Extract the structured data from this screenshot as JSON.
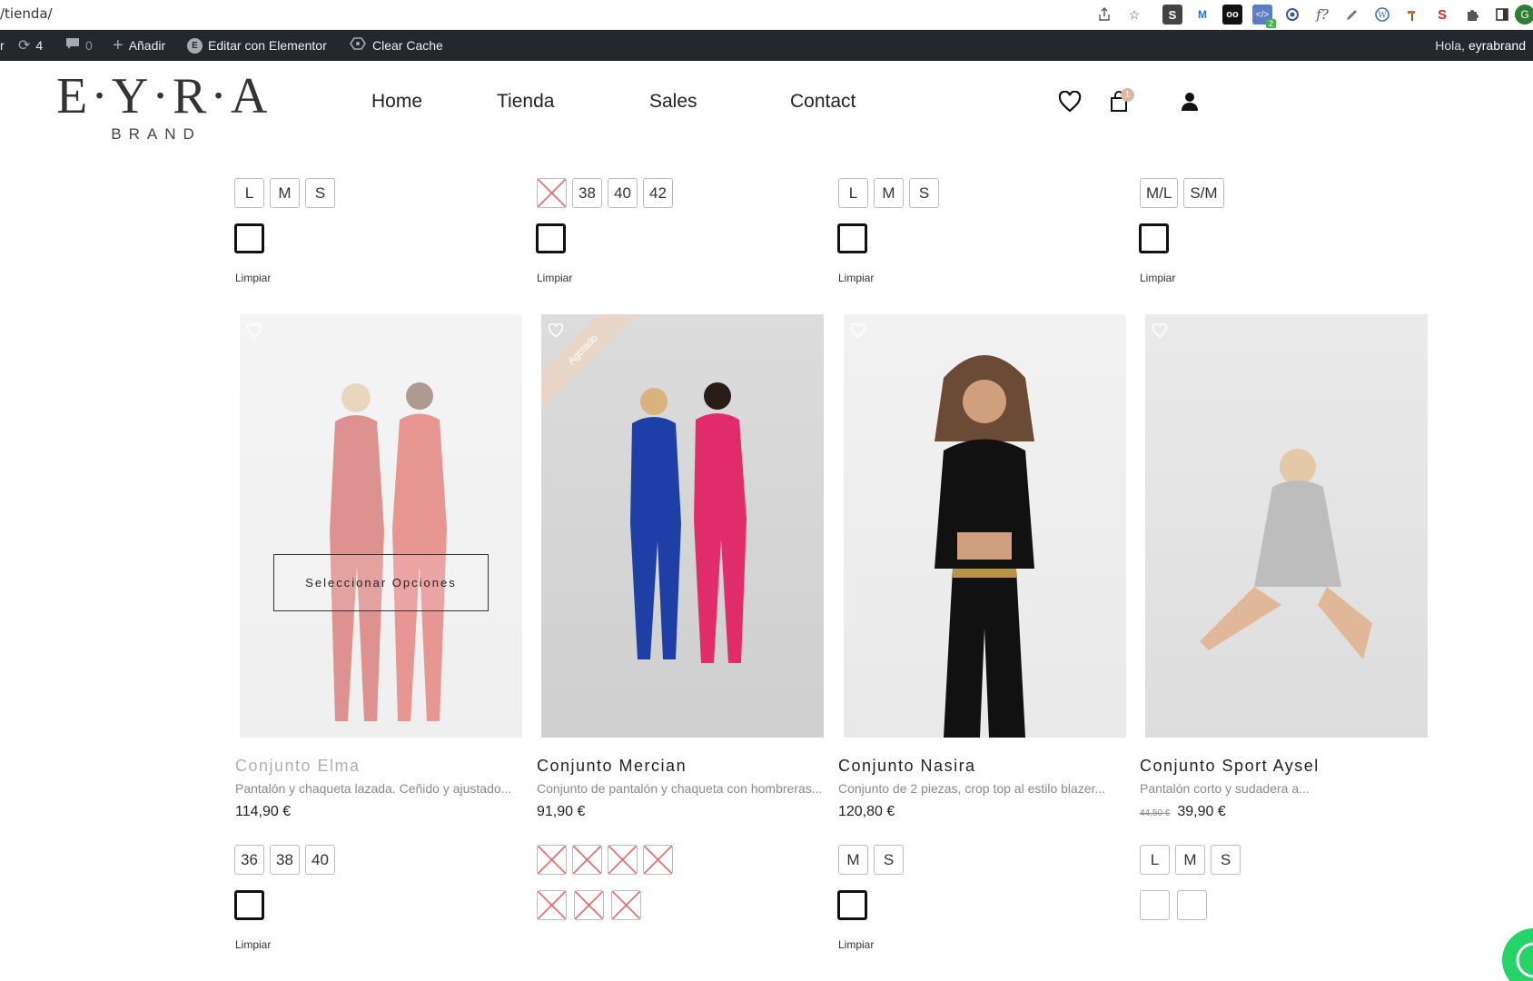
{
  "browser": {
    "url": "/tienda/",
    "extensions": [
      "share-icon",
      "star-icon",
      "s-ext-icon",
      "m-ext-icon",
      "oo-ext-icon",
      "code-ext-icon",
      "c-ext-icon",
      "f-ext-icon",
      "pen-ext-icon",
      "wordpress-icon",
      "hammer-ext-icon",
      "seo-ext-icon",
      "puzzle-icon",
      "sidebar-icon",
      "profile-icon"
    ],
    "code_ext_badge": "2",
    "f_ext_label": "f?"
  },
  "adminbar": {
    "updates_count": "4",
    "comments_count": "0",
    "add_label": "Añadir",
    "elementor_label": "Editar con Elementor",
    "cache_label": "Clear Cache",
    "greeting": "Hola,",
    "username": "eyrabrand"
  },
  "header": {
    "logo_main": "E·Y·R·A",
    "logo_sub": "BRAND",
    "nav": [
      "Home",
      "Tienda",
      "Sales",
      "Contact"
    ],
    "cart_count": "1"
  },
  "top_row": [
    {
      "sizes": [
        {
          "label": "L",
          "out": false
        },
        {
          "label": "M",
          "out": false
        },
        {
          "label": "S",
          "out": false
        }
      ],
      "colors": [
        {
          "hex": "#5bb5a7",
          "selected": true,
          "out": false
        }
      ],
      "clear": "Limpiar"
    },
    {
      "sizes": [
        {
          "label": "",
          "out": true
        },
        {
          "label": "38",
          "out": false
        },
        {
          "label": "40",
          "out": false
        },
        {
          "label": "42",
          "out": false
        }
      ],
      "colors": [
        {
          "hex": "#000000",
          "selected": true,
          "out": false
        }
      ],
      "clear": "Limpiar"
    },
    {
      "sizes": [
        {
          "label": "L",
          "out": false
        },
        {
          "label": "M",
          "out": false
        },
        {
          "label": "S",
          "out": false
        }
      ],
      "colors": [
        {
          "hex": "#c9c9c9",
          "selected": true,
          "out": false
        }
      ],
      "clear": "Limpiar"
    },
    {
      "sizes": [
        {
          "label": "M/L",
          "out": false
        },
        {
          "label": "S/M",
          "out": false
        }
      ],
      "colors": [
        {
          "hex": "#ece5e1",
          "selected": true,
          "out": false
        }
      ],
      "clear": "Limpiar"
    }
  ],
  "products": [
    {
      "name": "Conjunto Elma",
      "desc": "Pantalón y chaqueta lazada. Ceñido y ajustado...",
      "price": "114,90 €",
      "old_price": "",
      "image_desc": "red-suits",
      "hover_button": "Seleccionar Opciones",
      "ribbon": "",
      "sizes": [
        {
          "label": "36",
          "out": false
        },
        {
          "label": "38",
          "out": false
        },
        {
          "label": "40",
          "out": false
        }
      ],
      "colors": [
        {
          "hex": "#d0342c",
          "selected": true,
          "out": false
        }
      ],
      "clear": "Limpiar"
    },
    {
      "name": "Conjunto Mercian",
      "desc": "Conjunto de pantalón y chaqueta con hombreras...",
      "price": "91,90 €",
      "old_price": "",
      "image_desc": "blue-pink-suits",
      "hover_button": "",
      "ribbon": "Agotado",
      "sizes": [
        {
          "label": "",
          "out": true
        },
        {
          "label": "",
          "out": true
        },
        {
          "label": "",
          "out": true
        },
        {
          "label": "",
          "out": true
        }
      ],
      "colors": [
        {
          "hex": "#b9cfea",
          "selected": false,
          "out": true
        },
        {
          "hex": "#9a9a9a",
          "selected": false,
          "out": true
        },
        {
          "hex": "#f4c6cf",
          "selected": false,
          "out": true
        }
      ],
      "clear": ""
    },
    {
      "name": "Conjunto Nasira",
      "desc": "Conjunto de 2 piezas, crop top al estilo blazer...",
      "price": "120,80 €",
      "old_price": "",
      "image_desc": "black-outfit",
      "hover_button": "",
      "ribbon": "",
      "sizes": [
        {
          "label": "M",
          "out": false
        },
        {
          "label": "S",
          "out": false
        }
      ],
      "colors": [
        {
          "hex": "#000000",
          "selected": true,
          "out": false
        }
      ],
      "clear": "Limpiar"
    },
    {
      "name": "Conjunto Sport Aysel",
      "desc": "Pantalón corto y sudadera a...",
      "price": "39,90 €",
      "old_price": "44,50 €",
      "image_desc": "grey-hoodie",
      "hover_button": "",
      "ribbon": "",
      "sizes": [
        {
          "label": "L",
          "out": false
        },
        {
          "label": "M",
          "out": false
        },
        {
          "label": "S",
          "out": false
        }
      ],
      "colors": [
        {
          "hex": "#c9c9c9",
          "selected": false,
          "out": false
        },
        {
          "hex": "#000000",
          "selected": false,
          "out": false
        }
      ],
      "clear": ""
    }
  ]
}
